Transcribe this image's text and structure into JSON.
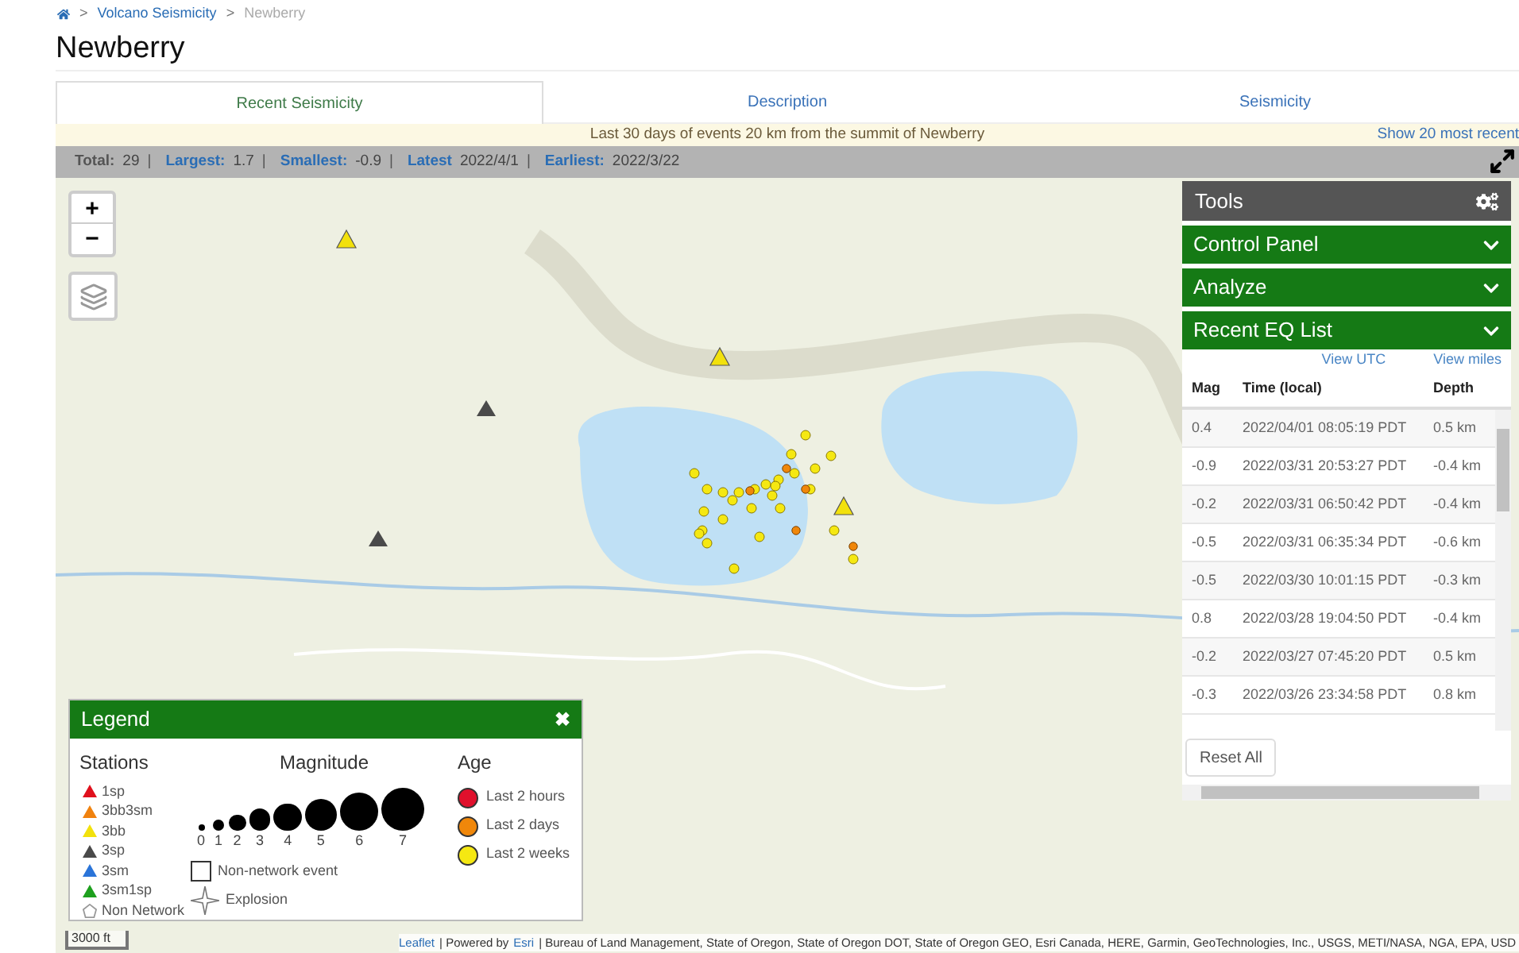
{
  "breadcrumb": [
    {
      "label": "Volcano Seismicity",
      "link": true
    },
    {
      "label": "Newberry",
      "link": false
    }
  ],
  "breadcrumb_separator": ">",
  "title": "Newberry",
  "tabs": [
    {
      "label": "Recent Seismicity",
      "selected": true
    },
    {
      "label": "Description",
      "selected": false
    },
    {
      "label": "Seismicity",
      "selected": false
    }
  ],
  "banner": {
    "text": "Last 30 days of events 20 km from the summit of Newberry",
    "link": "Show 20 most recent"
  },
  "stats": [
    {
      "label": "Total:",
      "value": "29",
      "separator": "|",
      "link": false
    },
    {
      "label": "Largest:",
      "value": "1.7",
      "separator": "|",
      "link": true
    },
    {
      "label": "Smallest:",
      "value": "-0.9",
      "separator": "|",
      "link": true
    },
    {
      "label": "Latest",
      "value": "2022/4/1",
      "separator": "|",
      "link": true
    },
    {
      "label": "Earliest:",
      "value": "2022/3/22",
      "link": true
    }
  ],
  "zoom_controls": [
    "+",
    "−"
  ],
  "tools": {
    "title": "Tools",
    "sections": [
      {
        "title": "Control Panel"
      },
      {
        "title": "Analyze"
      },
      {
        "title": "Recent EQ List"
      }
    ],
    "links": [
      "View UTC",
      "View miles"
    ],
    "columns": [
      "Mag",
      "Time (local)",
      "Depth"
    ],
    "rows": [
      [
        "0.4",
        "2022/04/01 08:05:19 PDT",
        "0.5 km"
      ],
      [
        "-0.9",
        "2022/03/31 20:53:27 PDT",
        "-0.4 km"
      ],
      [
        "-0.2",
        "2022/03/31 06:50:42 PDT",
        "-0.4 km"
      ],
      [
        "-0.5",
        "2022/03/31 06:35:34 PDT",
        "-0.6 km"
      ],
      [
        "-0.5",
        "2022/03/30 10:01:15 PDT",
        "-0.3 km"
      ],
      [
        "0.8",
        "2022/03/28 19:04:50 PDT",
        "-0.4 km"
      ],
      [
        "-0.2",
        "2022/03/27 07:45:20 PDT",
        "0.5 km"
      ],
      [
        "-0.3",
        "2022/03/26 23:34:58 PDT",
        "0.8 km"
      ]
    ],
    "reset_button": "Reset All"
  },
  "legend": {
    "title": "Legend",
    "close": "✖",
    "stations_heading": "Stations",
    "stations": [
      {
        "label": "1sp",
        "color": "#e0101c"
      },
      {
        "label": "3bb3sm",
        "color": "#f0820e"
      },
      {
        "label": "3bb",
        "color": "#f2e10c"
      },
      {
        "label": "3sp",
        "color": "#4a4a4a"
      },
      {
        "label": "3sm",
        "color": "#2a74d8"
      },
      {
        "label": "3sm1sp",
        "color": "#1ea01e"
      },
      {
        "label": "Non Network",
        "kind": "outline"
      }
    ],
    "magnitude_heading": "Magnitude",
    "magnitudes": [
      "0",
      "1",
      "2",
      "3",
      "4",
      "5",
      "6",
      "7"
    ],
    "age_heading": "Age",
    "ages": [
      {
        "label": "Last 2 hours",
        "color": "#e0102c"
      },
      {
        "label": "Last 2 days",
        "color": "#f0870a"
      },
      {
        "label": "Last 2 weeks",
        "color": "#f5e812"
      }
    ],
    "symbols": [
      {
        "kind": "square",
        "label": "Non-network event"
      },
      {
        "kind": "star",
        "label": "Explosion"
      }
    ]
  },
  "scale": "3000 ft",
  "attribution": [
    {
      "text": "Leaflet",
      "link": true
    },
    {
      "text": "| Powered by",
      "link": false
    },
    {
      "text": "Esri",
      "link": true
    },
    {
      "text": "| Bureau of Land Management, State of Oregon, State of Oregon DOT, State of Oregon GEO, Esri Canada, HERE, Garmin, GeoTechnologies, Inc., USGS, METI/NASA, NGA, EPA, USD",
      "link": false
    }
  ]
}
